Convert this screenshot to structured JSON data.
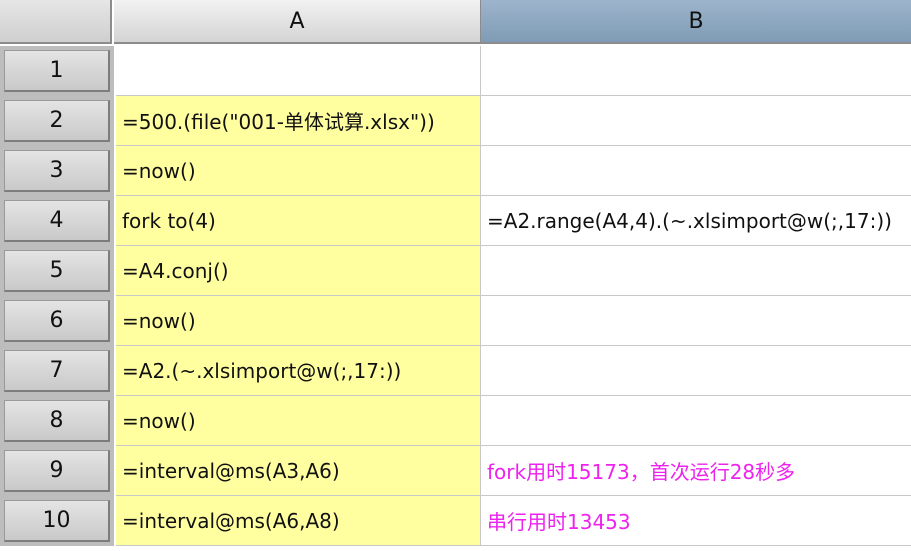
{
  "spreadsheet": {
    "columns": [
      {
        "label": "A"
      },
      {
        "label": "B"
      }
    ],
    "rows": [
      {
        "label": "1",
        "a": "",
        "b": ""
      },
      {
        "label": "2",
        "a": "=500.(file(\"001-单体试算.xlsx\"))",
        "b": ""
      },
      {
        "label": "3",
        "a": "=now()",
        "b": ""
      },
      {
        "label": "4",
        "a": "fork to(4)",
        "b": "=A2.range(A4,4).(~.xlsimport@w(;,17:))"
      },
      {
        "label": "5",
        "a": "=A4.conj()",
        "b": ""
      },
      {
        "label": "6",
        "a": "=now()",
        "b": ""
      },
      {
        "label": "7",
        "a": "=A2.(~.xlsimport@w(;,17:))",
        "b": ""
      },
      {
        "label": "8",
        "a": "=now()",
        "b": ""
      },
      {
        "label": "9",
        "a": "=interval@ms(A3,A6)",
        "b": "fork用时15173，首次运行28秒多"
      },
      {
        "label": "10",
        "a": "=interval@ms(A6,A8)",
        "b": "串行用时13453"
      }
    ],
    "colors": {
      "cell_fill_a": "#ffffa0",
      "selected_column_header": "#8fa9c2",
      "note_text": "#ee22ee"
    }
  }
}
